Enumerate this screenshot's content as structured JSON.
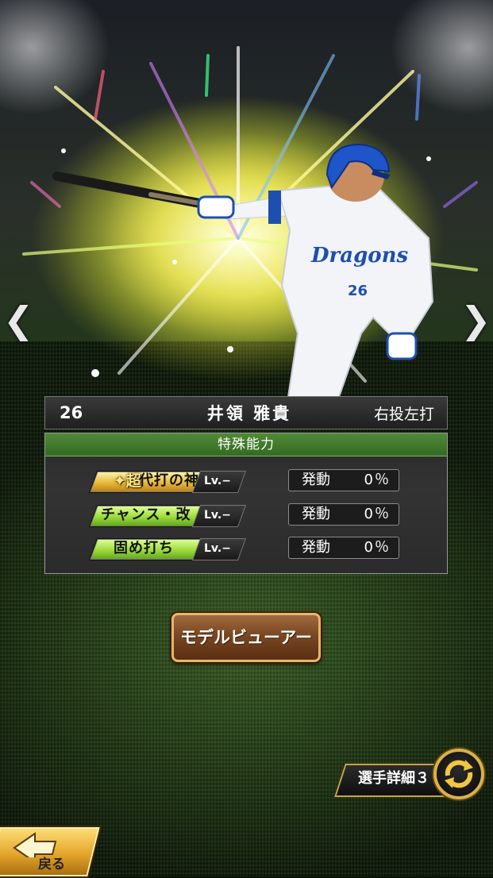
{
  "navigation": {
    "prev_icon": "chevron-left-icon",
    "next_icon": "chevron-right-icon",
    "prev_glyph": "❮",
    "next_glyph": "❯"
  },
  "player": {
    "number": "26",
    "name": "井領 雅貴",
    "handedness": "右投左打",
    "jersey_text": "Dragons",
    "jersey_number": "26"
  },
  "special_abilities": {
    "title": "特殊能力",
    "items": [
      {
        "prefix": "超",
        "name": "代打の神様",
        "level": "Lv.−",
        "status_label": "発動",
        "rate": "0％",
        "tier": "gold"
      },
      {
        "prefix": "",
        "name": "チャンス・改",
        "level": "Lv.−",
        "status_label": "発動",
        "rate": "0％",
        "tier": "green"
      },
      {
        "prefix": "",
        "name": "固め打ち",
        "level": "Lv.−",
        "status_label": "発動",
        "rate": "0％",
        "tier": "green"
      }
    ]
  },
  "model_viewer_button": "モデルビューアー",
  "detail_tab": {
    "label": "選手詳細３",
    "switch_icon": "rotate-arrows-icon"
  },
  "back_button": {
    "label": "戻る",
    "icon": "back-arrow-icon"
  },
  "colors": {
    "accent_gold": "#d8b24a",
    "ability_green": "#9cdb3a",
    "header_green": "#356a22",
    "button_brown": "#7a4722"
  }
}
